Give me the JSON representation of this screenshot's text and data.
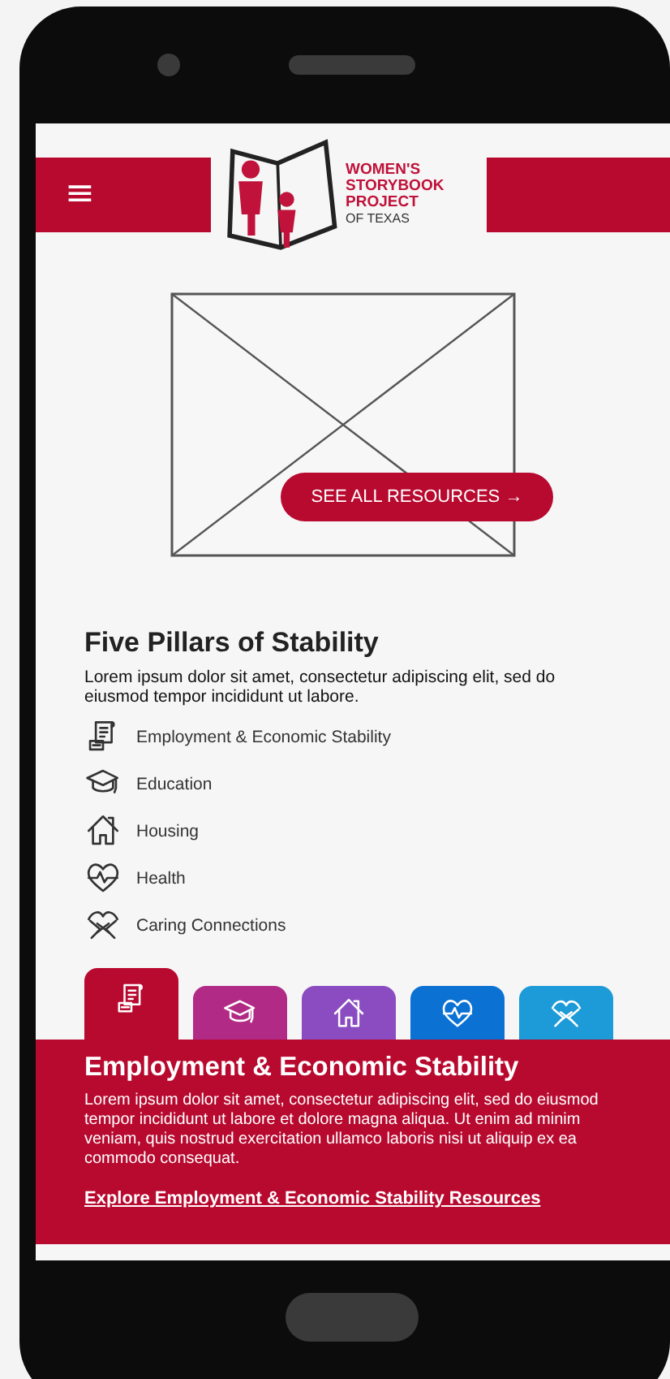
{
  "header": {
    "menu_icon": "≡",
    "logo_lines": [
      "WOMEN'S",
      "STORYBOOK",
      "PROJECT"
    ],
    "logo_sub": "OF TEXAS"
  },
  "hero": {
    "button": "SEE ALL RESOURCES →"
  },
  "pillars": {
    "title": "Five Pillars of Stability",
    "text": "Lorem ipsum dolor sit amet, consectetur adipiscing elit, sed do eiusmod tempor incididunt ut labore.",
    "items": [
      {
        "label": "Employment & Economic Stability"
      },
      {
        "label": "Education"
      },
      {
        "label": "Housing"
      },
      {
        "label": "Health"
      },
      {
        "label": "Caring Connections"
      }
    ]
  },
  "tabs": [
    {
      "color": "#b8092f",
      "selected": true
    },
    {
      "color": "#b12a86",
      "selected": false
    },
    {
      "color": "#8a4cc0",
      "selected": false
    },
    {
      "color": "#0b72d4",
      "selected": false
    },
    {
      "color": "#1d9ad8",
      "selected": false
    }
  ],
  "panel": {
    "title": "Employment & Economic Stability",
    "text": "Lorem ipsum dolor sit amet, consectetur adipiscing elit, sed do eiusmod  tempor incididunt ut labore et dolore magna aliqua. Ut enim ad minim  veniam, quis nostrud exercitation ullamco laboris nisi ut aliquip ex ea  commodo consequat.",
    "link": "Explore Employment & Economic Stability Resources"
  }
}
